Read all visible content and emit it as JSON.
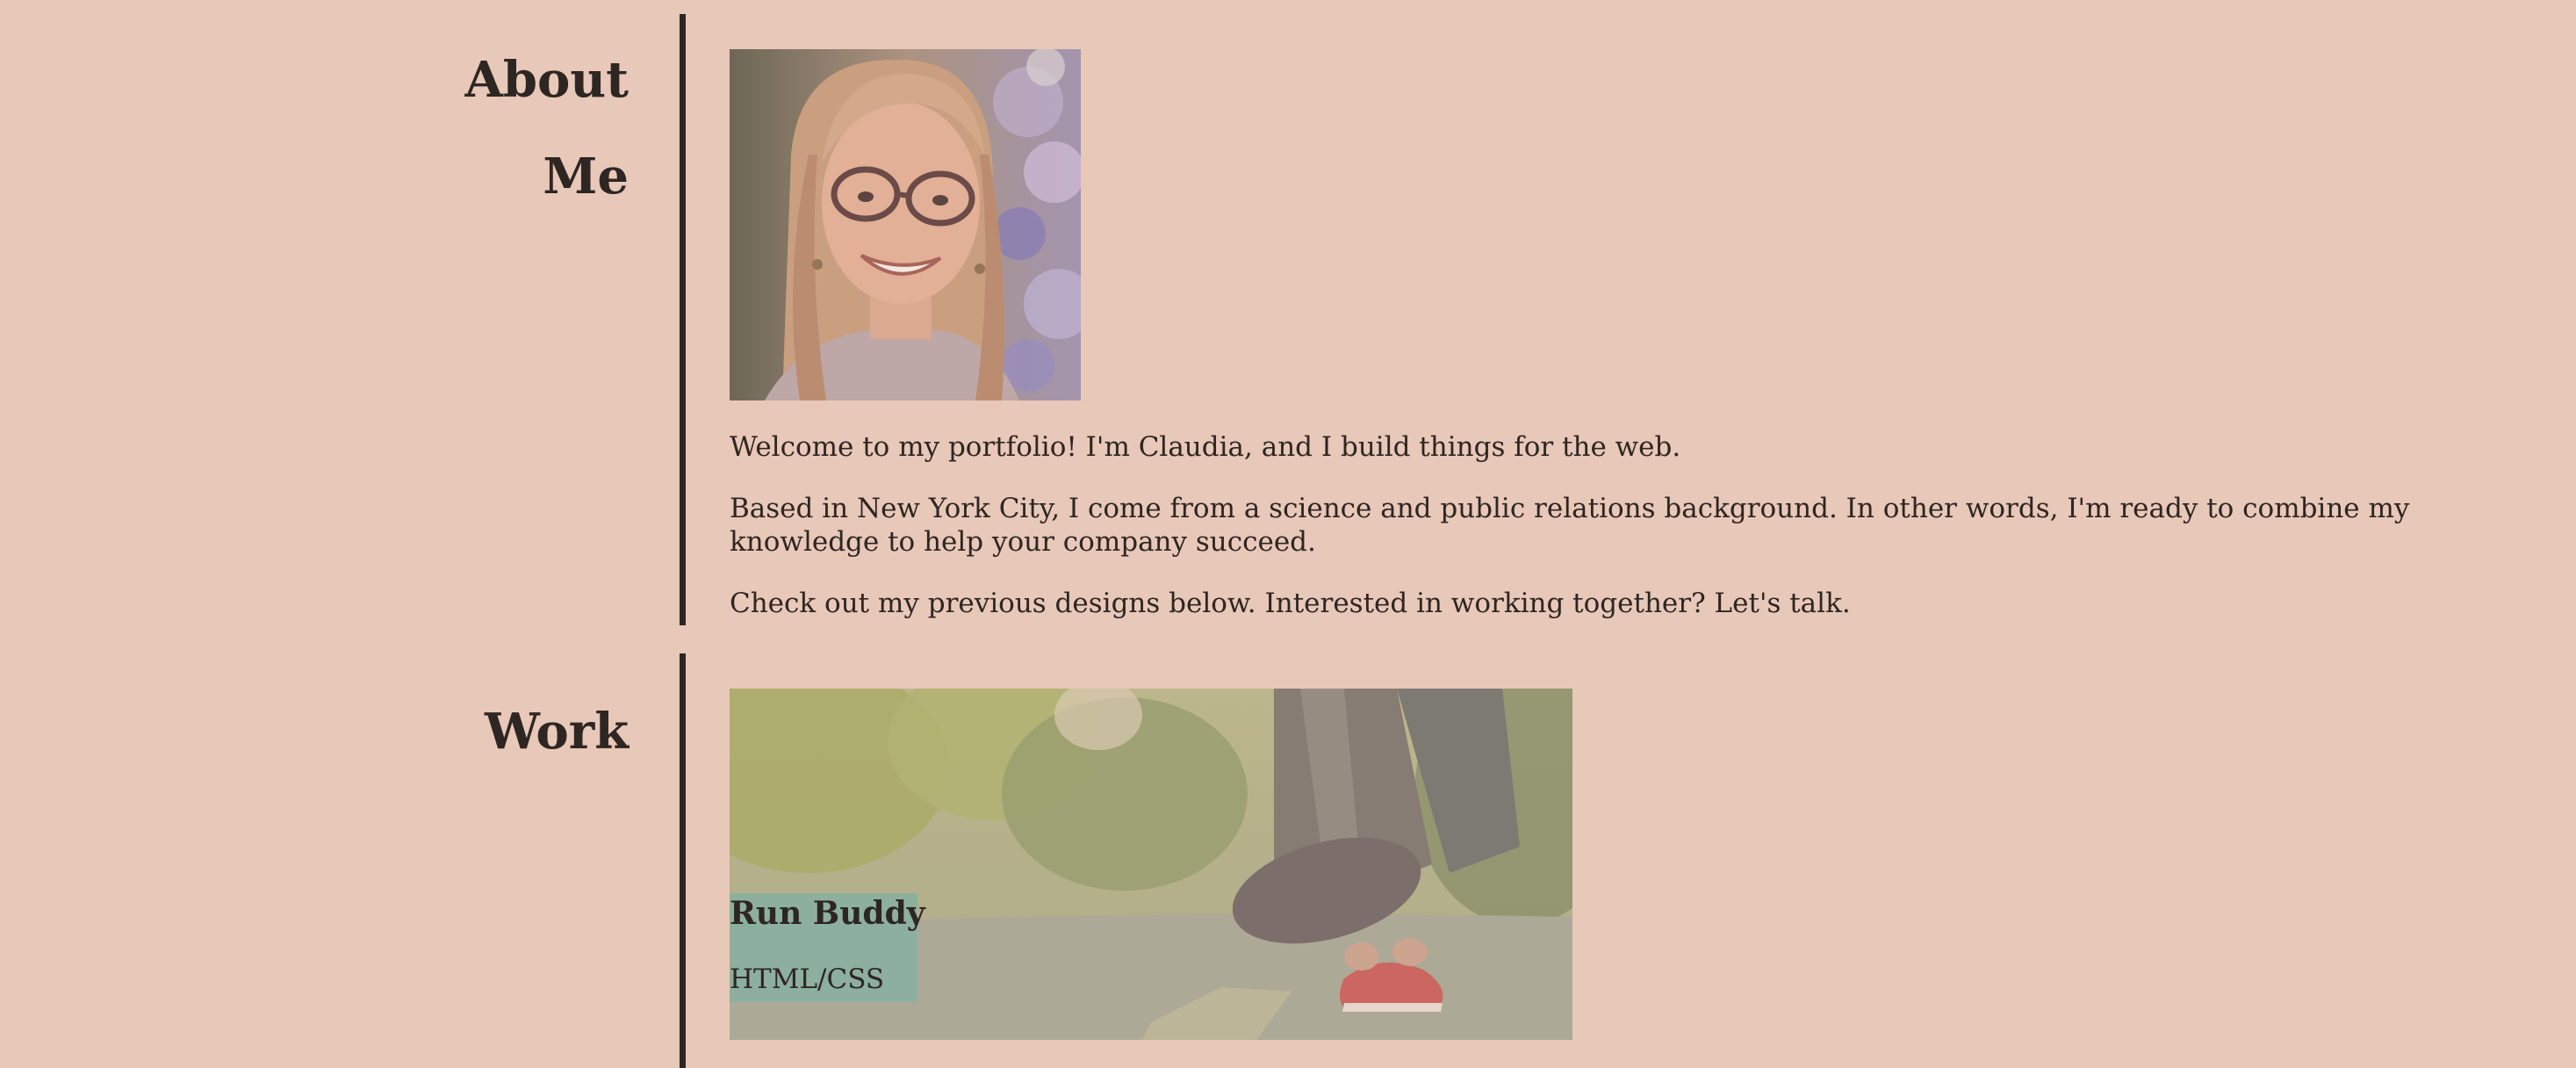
{
  "about": {
    "title_line1": "About",
    "title_line2": "Me",
    "paragraphs": [
      "Welcome to my portfolio! I'm Claudia, and I build things for the web.",
      "Based in New York City, I come from a science and public relations background. In other words, I'm ready to combine my knowledge to help your company succeed.",
      "Check out my previous designs below. Interested in working together? Let's talk."
    ]
  },
  "work": {
    "title": "Work",
    "projects": [
      {
        "name": "Run Buddy",
        "tech": "HTML/CSS"
      }
    ]
  },
  "colors": {
    "background": "#e8c8b8",
    "text": "#2e2622",
    "caption_bg": "#8ab0a0"
  },
  "icons": {
    "avatar": "profile-photo",
    "project_image": "runner-tying-shoe-photo"
  }
}
